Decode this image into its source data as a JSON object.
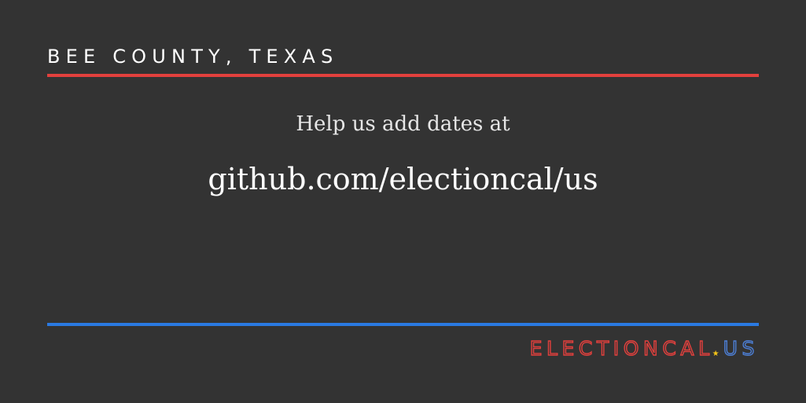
{
  "header": {
    "title": "BEE COUNTY, TEXAS"
  },
  "message": {
    "prompt": "Help us add dates at",
    "link": "github.com/electioncal/us"
  },
  "logo": {
    "word": "ELECTIONCAL",
    "separator_icon": "star-icon",
    "tld": "US"
  },
  "colors": {
    "background": "#333333",
    "accent_red": "#e2403d",
    "accent_blue": "#2a7ae2",
    "star_yellow": "#f5c518"
  }
}
